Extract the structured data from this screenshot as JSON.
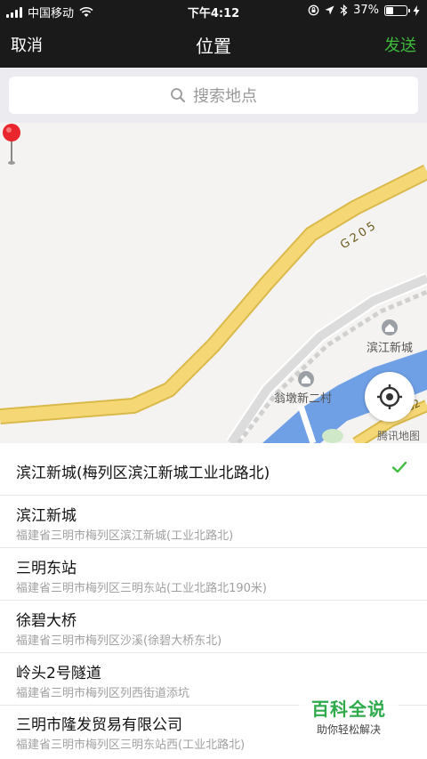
{
  "status_bar": {
    "carrier": "中国移动",
    "time": "下午4:12",
    "battery_percent": "37%",
    "battery_level": 0.37,
    "icons": [
      "signal-icon",
      "wifi-icon",
      "lock-rotation-icon",
      "location-arrow-icon",
      "bluetooth-icon",
      "battery-icon",
      "charging-icon"
    ]
  },
  "nav": {
    "cancel": "取消",
    "title": "位置",
    "send": "发送"
  },
  "search": {
    "placeholder": "搜索地点"
  },
  "map": {
    "road_label": "G205",
    "place_labels": [
      "滨江新城",
      "翁墩新二村"
    ],
    "attribution": "腾讯地图",
    "road_label_right": "G2"
  },
  "list": [
    {
      "name": "滨江新城(梅列区滨江新城工业北路北)",
      "addr": "",
      "selected": true
    },
    {
      "name": "滨江新城",
      "addr": "福建省三明市梅列区滨江新城(工业北路北)",
      "selected": false
    },
    {
      "name": "三明东站",
      "addr": "福建省三明市梅列区三明东站(工业北路北190米)",
      "selected": false
    },
    {
      "name": "徐碧大桥",
      "addr": "福建省三明市梅列区沙溪(徐碧大桥东北)",
      "selected": false
    },
    {
      "name": "岭头2号隧道",
      "addr": "福建省三明市梅列区列西街道添坑",
      "selected": false
    },
    {
      "name": "三明市隆发贸易有限公司",
      "addr": "福建省三明市梅列区三明东站西(工业北路北)",
      "selected": false
    }
  ],
  "watermark": {
    "title": "百科全说",
    "subtitle": "助你轻松解决"
  },
  "colors": {
    "bar_bg": "#1a1a1a",
    "accent_green": "#3dbb3d",
    "road_yellow": "#f2d36b",
    "river_blue": "#6fa0e6"
  }
}
